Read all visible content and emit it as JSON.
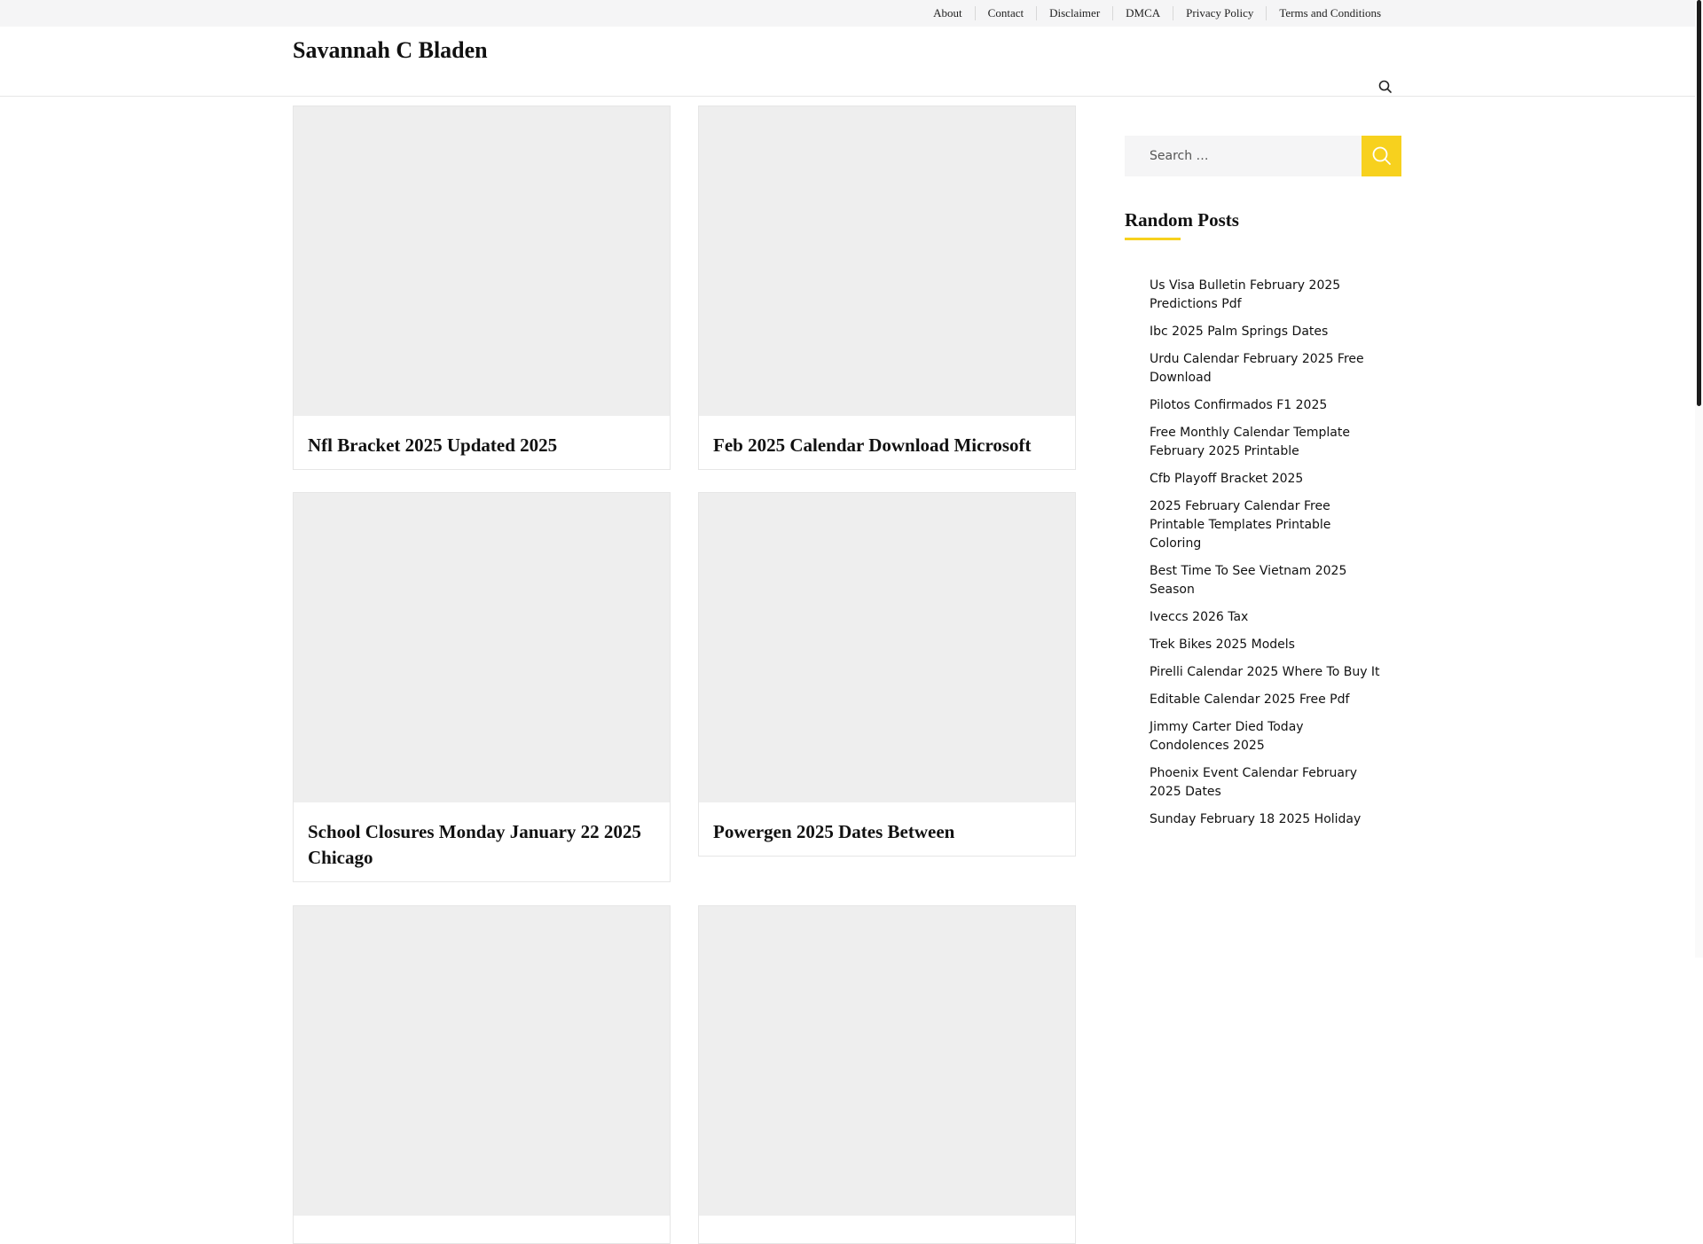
{
  "top_nav": [
    "About",
    "Contact",
    "Disclaimer",
    "DMCA",
    "Privacy Policy",
    "Terms and Conditions"
  ],
  "site": {
    "title": "Savannah C Bladen"
  },
  "posts": [
    {
      "title": "Nfl Bracket 2025 Updated 2025"
    },
    {
      "title": "Feb 2025 Calendar Download Microsoft"
    },
    {
      "title": "School Closures Monday January 22 2025 Chicago"
    },
    {
      "title": "Powergen 2025 Dates Between"
    },
    {
      "title": ""
    },
    {
      "title": ""
    }
  ],
  "sidebar": {
    "search_placeholder": "Search …",
    "heading": "Random Posts",
    "random_posts": [
      "Us Visa Bulletin February 2025 Predictions Pdf",
      "Ibc 2025 Palm Springs Dates",
      "Urdu Calendar February 2025 Free Download",
      "Pilotos Confirmados F1 2025",
      "Free Monthly Calendar Template February 2025 Printable",
      "Cfb Playoff Bracket 2025",
      "2025 February Calendar Free Printable Templates Printable Coloring",
      "Best Time To See Vietnam 2025 Season",
      "Iveccs 2026 Tax",
      "Trek Bikes 2025 Models",
      "Pirelli Calendar 2025 Where To Buy It",
      "Editable Calendar 2025 Free Pdf",
      "Jimmy Carter Died Today Condolences 2025",
      "Phoenix Event Calendar February 2025 Dates",
      "Sunday February 18 2025 Holiday"
    ]
  },
  "colors": {
    "accent": "#f7d11e",
    "placeholder_bg": "#eeeeee",
    "topbar_bg": "#f5f5f6"
  },
  "icons": {
    "header_search": "search-icon",
    "sidebar_search": "search-icon"
  }
}
